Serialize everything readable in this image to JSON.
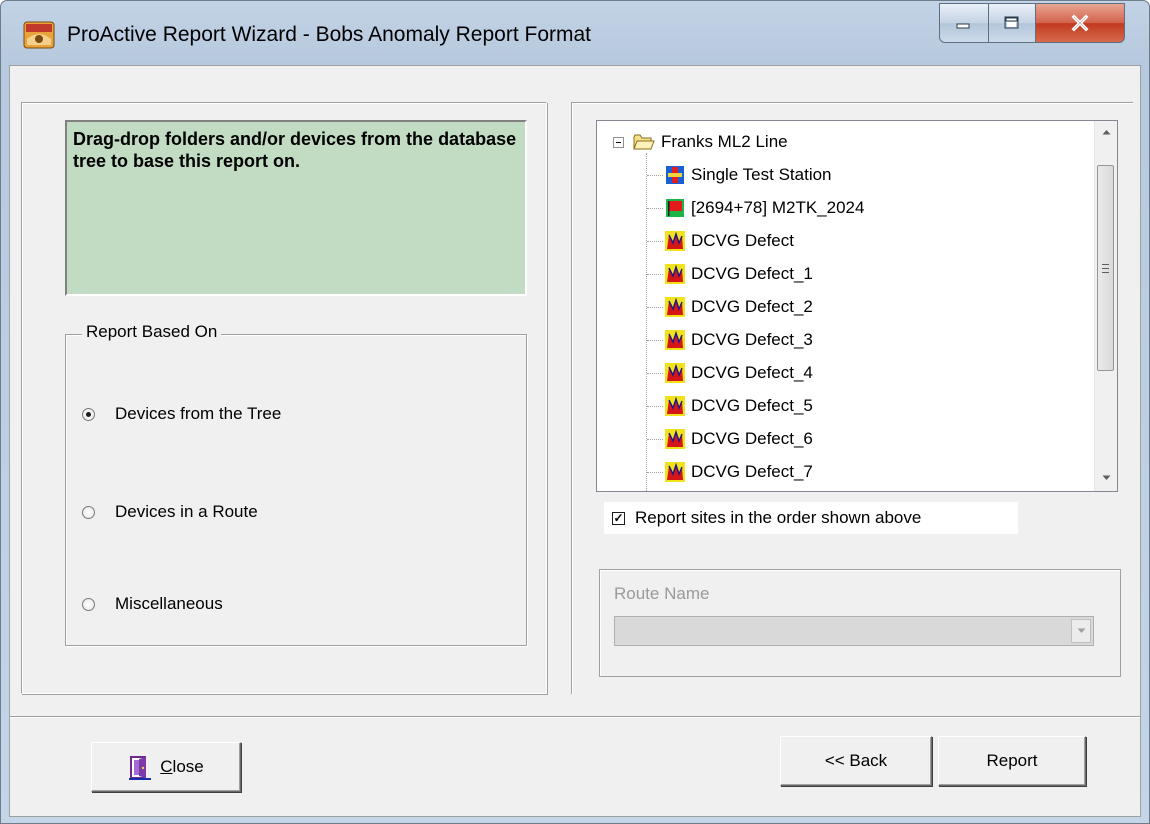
{
  "window": {
    "title": "ProActive Report Wizard - Bobs Anomaly Report Format",
    "controls": [
      "minimize-icon",
      "maximize-icon",
      "close-icon"
    ]
  },
  "info_box": {
    "text": "Drag-drop folders and/or devices from the database tree to base this report on.",
    "background": "#c1dcc2"
  },
  "report_based_on": {
    "legend": "Report Based On",
    "options": [
      {
        "label": "Devices from the Tree",
        "checked": true
      },
      {
        "label": "Devices in a Route",
        "checked": false
      },
      {
        "label": "Miscellaneous",
        "checked": false
      }
    ]
  },
  "tree": {
    "root": {
      "label": "Franks ML2 Line",
      "icon": "folder-icon",
      "expanded": true
    },
    "items": [
      {
        "label": "Single Test Station",
        "icon": "test-station-icon"
      },
      {
        "label": "[2694+78] M2TK_2024",
        "icon": "flag-icon"
      },
      {
        "label": "DCVG Defect",
        "icon": "dcvg-defect-icon"
      },
      {
        "label": "DCVG Defect_1",
        "icon": "dcvg-defect-icon"
      },
      {
        "label": "DCVG Defect_2",
        "icon": "dcvg-defect-icon"
      },
      {
        "label": "DCVG Defect_3",
        "icon": "dcvg-defect-icon"
      },
      {
        "label": "DCVG Defect_4",
        "icon": "dcvg-defect-icon"
      },
      {
        "label": "DCVG Defect_5",
        "icon": "dcvg-defect-icon"
      },
      {
        "label": "DCVG Defect_6",
        "icon": "dcvg-defect-icon"
      },
      {
        "label": "DCVG Defect_7",
        "icon": "dcvg-defect-icon"
      }
    ]
  },
  "order_checkbox": {
    "label": "Report sites in the order shown above",
    "checked": true
  },
  "route": {
    "label": "Route Name",
    "value": "",
    "enabled": false
  },
  "buttons": {
    "close_prefix": "",
    "close_accel": "C",
    "close_rest": "lose",
    "back": "<< Back",
    "report": "Report"
  }
}
